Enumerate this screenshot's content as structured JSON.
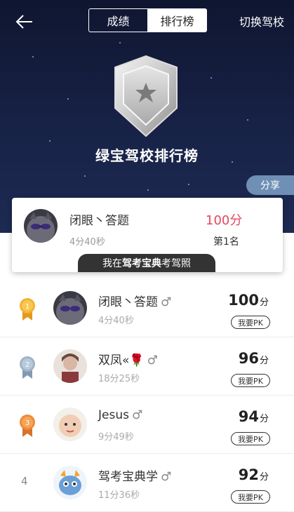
{
  "header": {
    "tabs": [
      {
        "label": "成绩",
        "active": false
      },
      {
        "label": "排行榜",
        "active": true
      }
    ],
    "switch_label": "切换驾校",
    "back_icon": "back-arrow-icon"
  },
  "hero": {
    "title": "绿宝驾校排行榜",
    "share_label": "分享",
    "badge_icon": "shield-star-icon"
  },
  "my_card": {
    "name": "闭眼丶答题",
    "time": "4分40秒",
    "score": "100分",
    "rank": "第1名",
    "promo_prefix": "我在",
    "promo_brand": "驾考宝典",
    "promo_suffix": "考驾照"
  },
  "ranking": [
    {
      "rank": "1",
      "medal": "gold",
      "name": "闭眼丶答题",
      "gender": "♂",
      "time": "4分40秒",
      "score": "100",
      "unit": "分",
      "pk_label": "我要PK"
    },
    {
      "rank": "2",
      "medal": "silver",
      "name": "双凤«🌹",
      "gender": "♂",
      "time": "18分25秒",
      "score": "96",
      "unit": "分",
      "pk_label": "我要PK"
    },
    {
      "rank": "3",
      "medal": "bronze",
      "name": "Jesus",
      "gender": "♂",
      "time": "9分49秒",
      "score": "94",
      "unit": "分",
      "pk_label": "我要PK"
    },
    {
      "rank": "4",
      "medal": "",
      "name": "驾考宝典学",
      "gender": "♂",
      "time": "11分36秒",
      "score": "92",
      "unit": "分",
      "pk_label": "我要PK"
    }
  ],
  "colors": {
    "hero_bg": "#182247",
    "score_red": "#e3485e",
    "share_bg": "#6f8fb5",
    "gold": "#f2b233",
    "silver": "#9fb3c8",
    "bronze": "#ef8a3a"
  }
}
